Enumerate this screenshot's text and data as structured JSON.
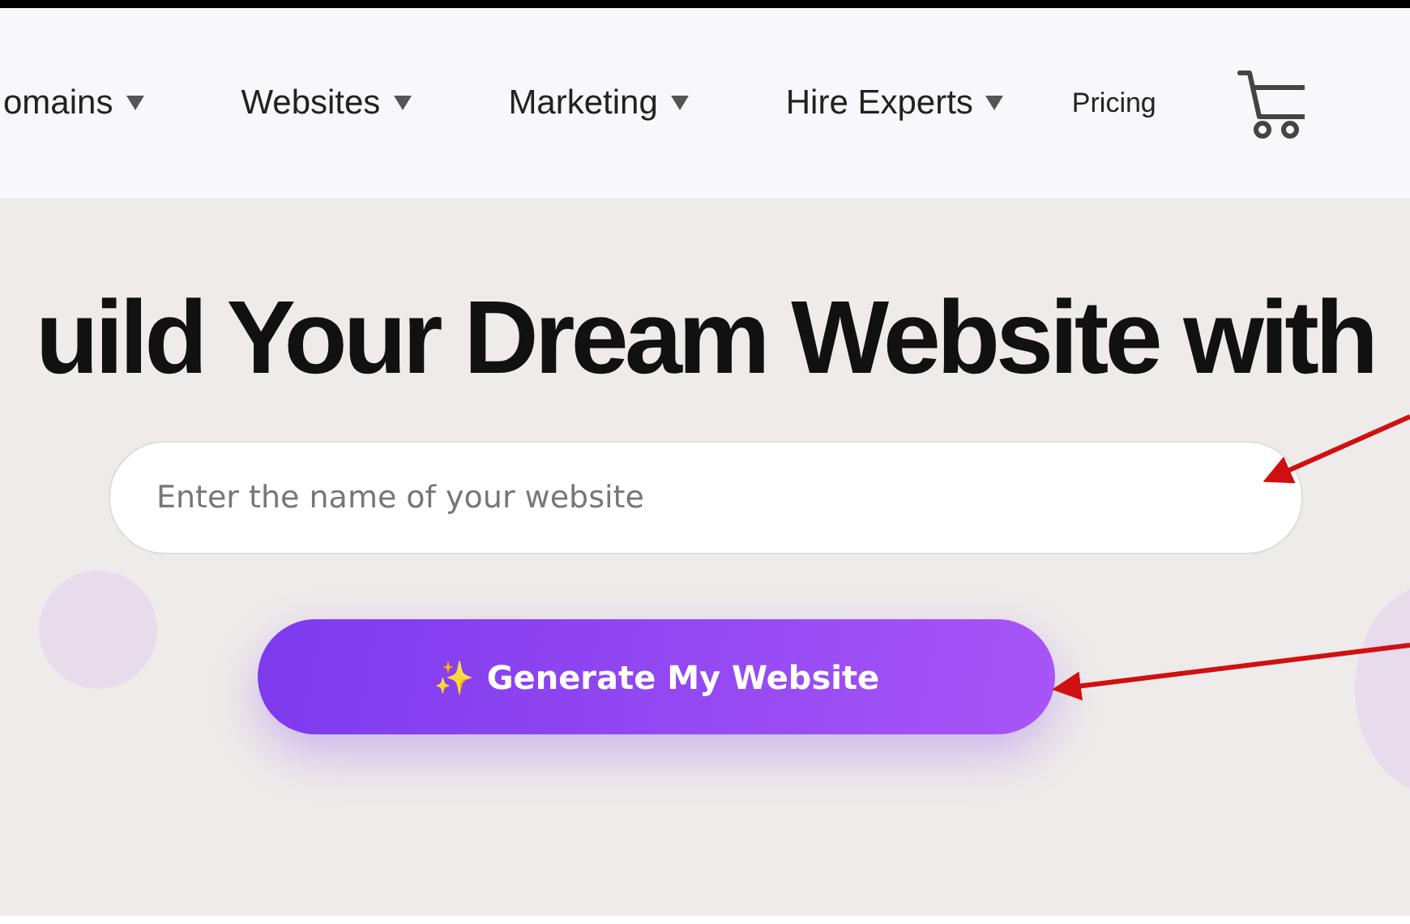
{
  "nav": {
    "items": [
      {
        "label": "omains",
        "dropdown": true
      },
      {
        "label": "Websites",
        "dropdown": true
      },
      {
        "label": "Marketing",
        "dropdown": true
      },
      {
        "label": "Hire Experts",
        "dropdown": true
      },
      {
        "label": "Pricing",
        "dropdown": false
      }
    ]
  },
  "hero": {
    "heading": "uild Your Dream Website with",
    "input": {
      "placeholder": "Enter the name of your website"
    },
    "button": {
      "icon": "✨",
      "label": "Generate My Website"
    }
  }
}
